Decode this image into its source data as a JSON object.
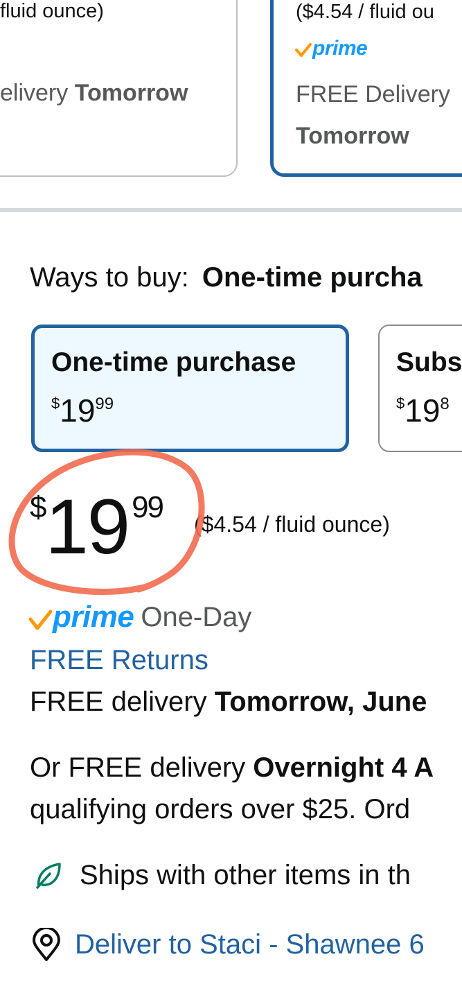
{
  "top_cards": {
    "left": {
      "unit_price_fragment": "fluid ounce)",
      "delivery_prefix": "elivery",
      "delivery_day": "Tomorrow"
    },
    "right": {
      "unit_price_fragment": "($4.54 / fluid ou",
      "prime_label": "prime",
      "delivery_prefix": "FREE Delivery",
      "delivery_day": "Tomorrow"
    }
  },
  "ways_to_buy": {
    "label": "Ways to buy:",
    "selected_value": "One-time purcha",
    "options": [
      {
        "title": "One-time purchase",
        "currency": "$",
        "whole": "19",
        "fraction": "99",
        "selected": true
      },
      {
        "title": "Subs",
        "currency": "$",
        "whole": "19",
        "fraction": "8",
        "selected": false
      }
    ]
  },
  "price": {
    "currency": "$",
    "whole": "19",
    "fraction": "99",
    "unit_price": "($4.54 / fluid ounce)"
  },
  "prime": {
    "label": "prime",
    "speed": "One-Day"
  },
  "returns_link": "FREE Returns",
  "delivery": {
    "prefix": "FREE delivery",
    "date": "Tomorrow, June"
  },
  "overnight": {
    "line1_prefix": "Or FREE delivery",
    "line1_bold": "Overnight 4 A",
    "line2": "qualifying orders over $25. Ord"
  },
  "ships_with": "Ships with other items in th",
  "deliver_to": "Deliver to Staci - Shawnee 6",
  "colors": {
    "link_blue": "#2162a1",
    "prime_blue": "#1399ff",
    "prime_check_orange": "#ff9900",
    "annotation_red": "#f26b4f",
    "leaf_green": "#067d62"
  }
}
